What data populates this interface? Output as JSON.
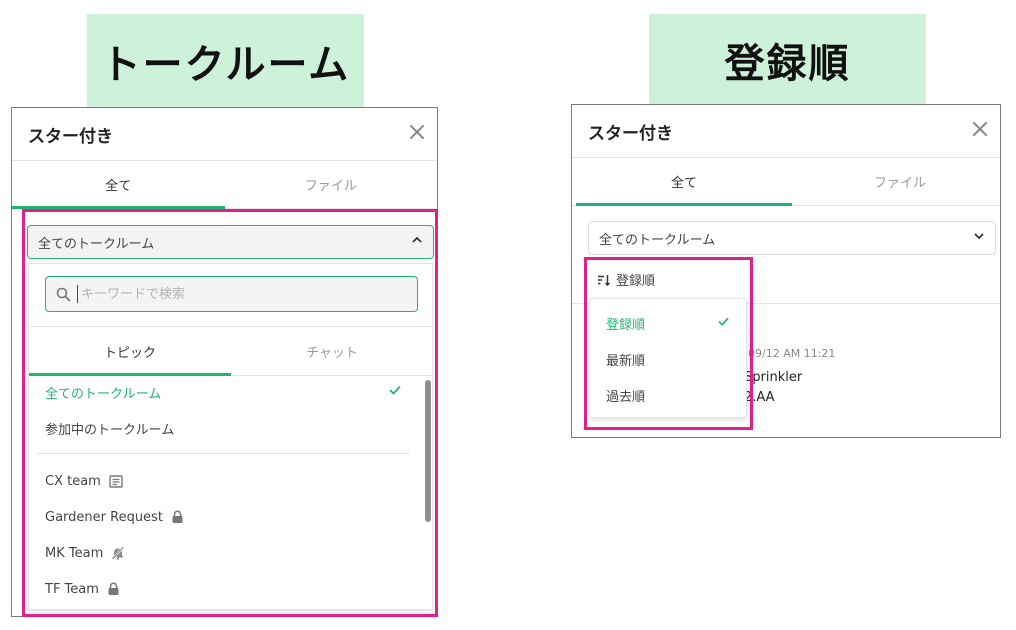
{
  "left": {
    "caption": "トークルーム",
    "panel_title": "スター付き",
    "tabs": [
      "全て",
      "ファイル"
    ],
    "room_select_value": "全てのトークルーム",
    "search_placeholder": "キーワードで検索",
    "subtabs": [
      "トピック",
      "チャット"
    ],
    "preset_items": [
      {
        "label": "全てのトークルーム",
        "selected": true
      },
      {
        "label": "参加中のトークルーム",
        "selected": false
      }
    ],
    "rooms": [
      {
        "label": "CX team",
        "icon": "topic-board-icon"
      },
      {
        "label": "Gardener Request",
        "icon": "lock-icon"
      },
      {
        "label": "MK Team",
        "icon": "bell-off-icon"
      },
      {
        "label": "TF Team",
        "icon": "lock-icon"
      }
    ]
  },
  "right": {
    "caption": "登録順",
    "panel_title": "スター付き",
    "tabs": [
      "全て",
      "ファイル"
    ],
    "room_select_value": "全てのトークルーム",
    "sort_label": "登録順",
    "sort_options": [
      {
        "label": "登録順",
        "selected": true
      },
      {
        "label": "最新順",
        "selected": false
      },
      {
        "label": "過去順",
        "selected": false
      }
    ],
    "bg_time": "09/12 AM 11:21",
    "bg_line1": "Sprinkler",
    "bg_line2": "2.AA"
  },
  "colors": {
    "accent": "#21b573",
    "highlight": "#e0218a",
    "caption_bg": "#cdf1d9"
  }
}
